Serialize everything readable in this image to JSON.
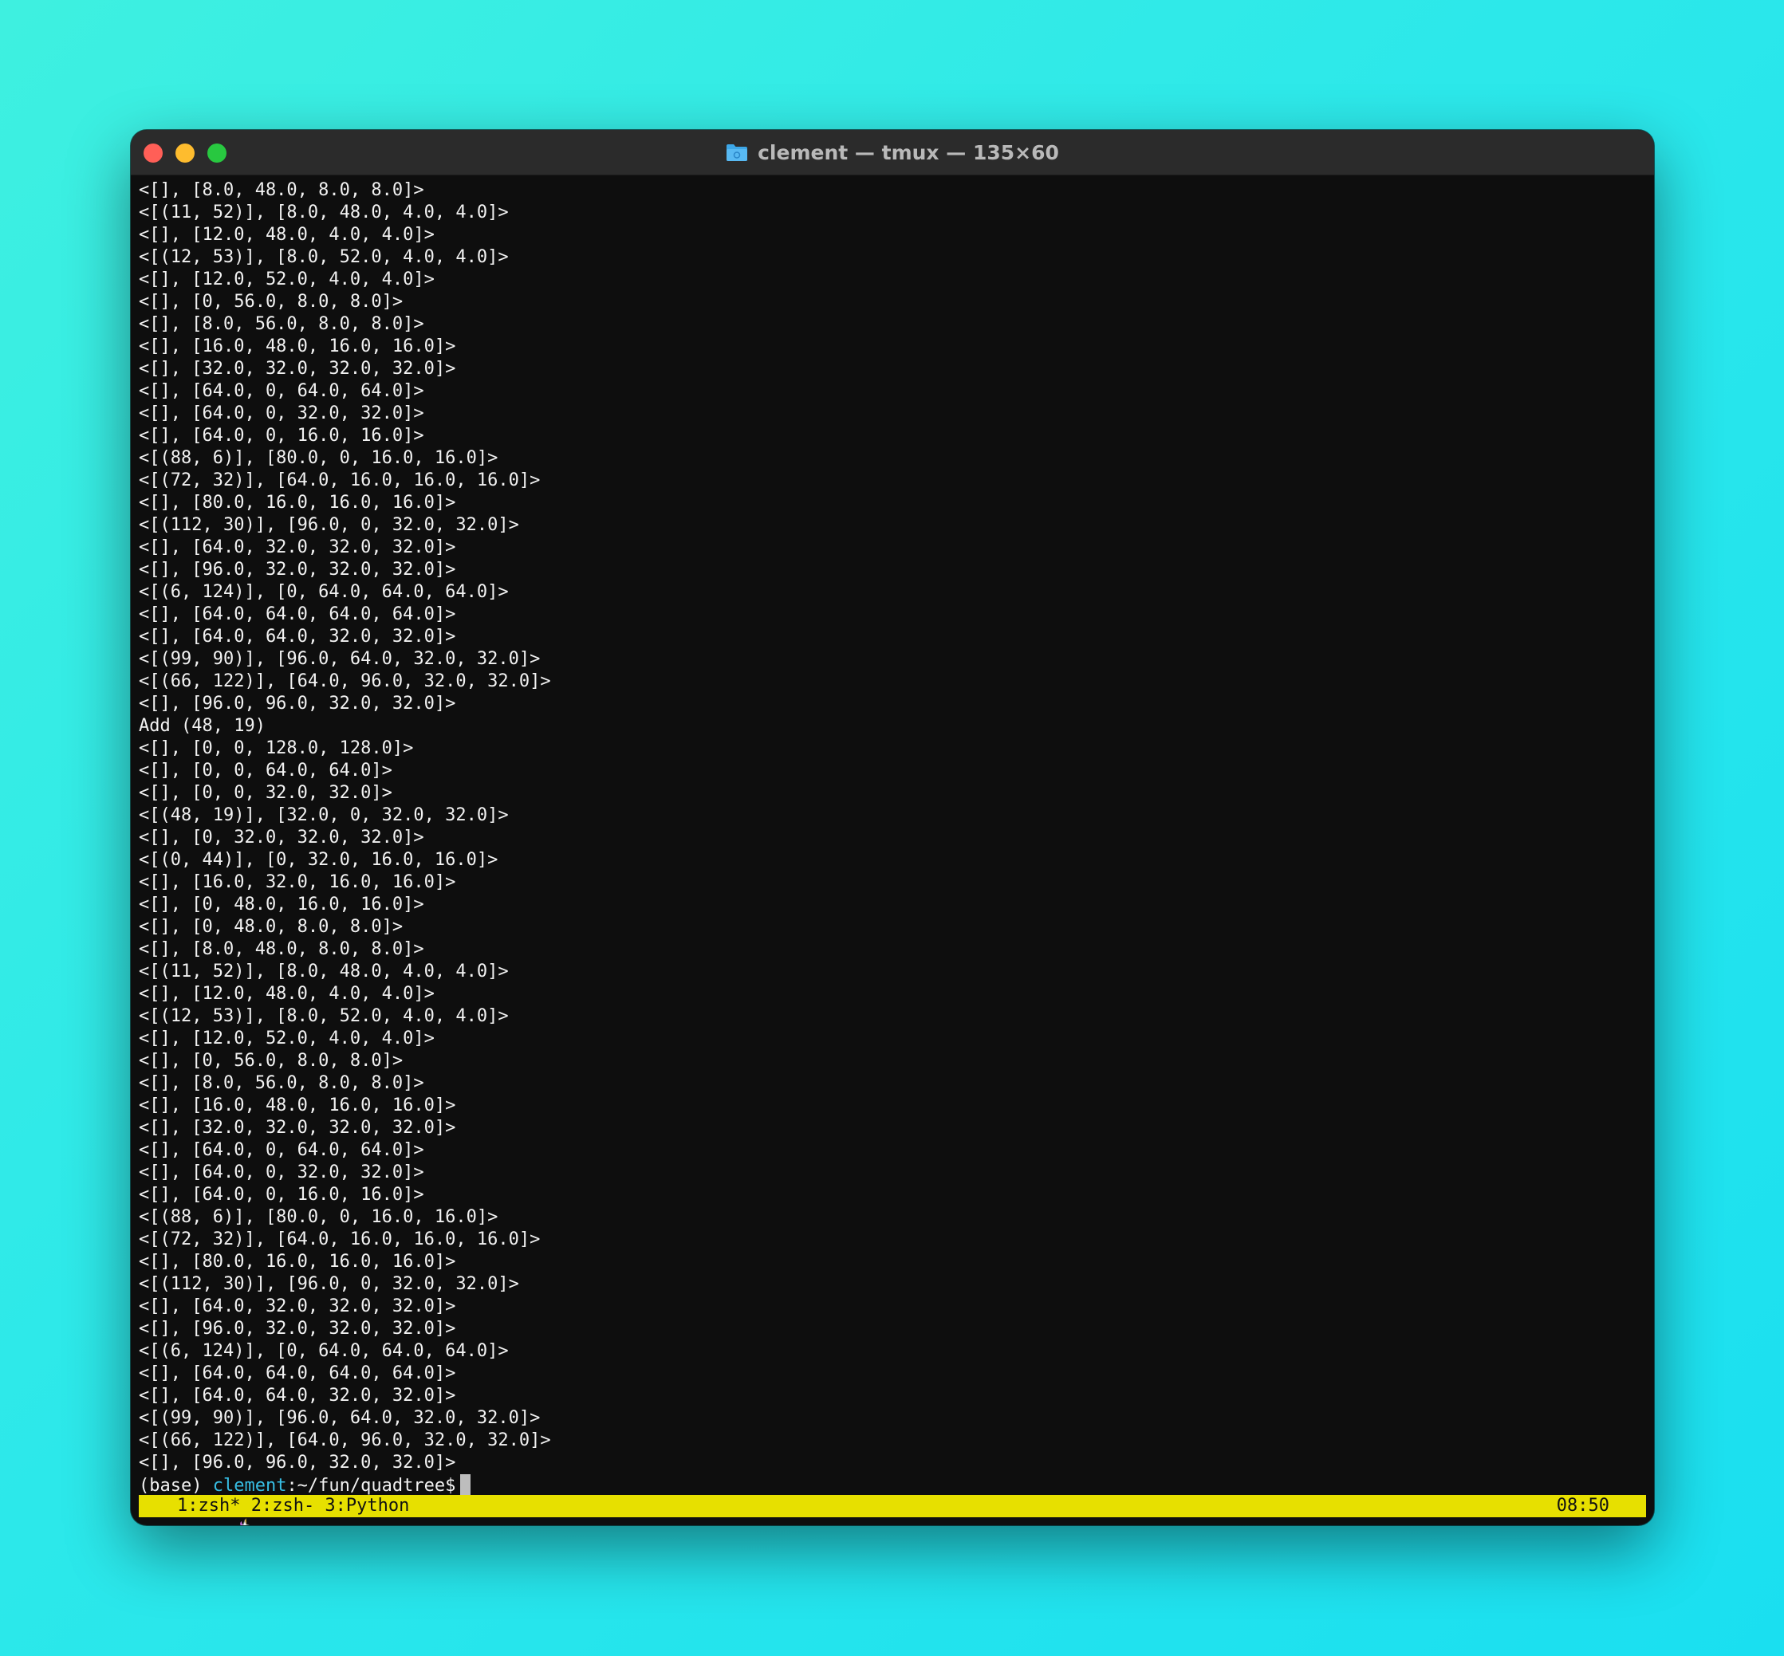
{
  "window": {
    "title": "clement — tmux — 135×60",
    "folder_icon": "folder-icon"
  },
  "terminal": {
    "lines": [
      "<[], [8.0, 48.0, 8.0, 8.0]>",
      "<[(11, 52)], [8.0, 48.0, 4.0, 4.0]>",
      "<[], [12.0, 48.0, 4.0, 4.0]>",
      "<[(12, 53)], [8.0, 52.0, 4.0, 4.0]>",
      "<[], [12.0, 52.0, 4.0, 4.0]>",
      "<[], [0, 56.0, 8.0, 8.0]>",
      "<[], [8.0, 56.0, 8.0, 8.0]>",
      "<[], [16.0, 48.0, 16.0, 16.0]>",
      "<[], [32.0, 32.0, 32.0, 32.0]>",
      "<[], [64.0, 0, 64.0, 64.0]>",
      "<[], [64.0, 0, 32.0, 32.0]>",
      "<[], [64.0, 0, 16.0, 16.0]>",
      "<[(88, 6)], [80.0, 0, 16.0, 16.0]>",
      "<[(72, 32)], [64.0, 16.0, 16.0, 16.0]>",
      "<[], [80.0, 16.0, 16.0, 16.0]>",
      "<[(112, 30)], [96.0, 0, 32.0, 32.0]>",
      "<[], [64.0, 32.0, 32.0, 32.0]>",
      "<[], [96.0, 32.0, 32.0, 32.0]>",
      "<[(6, 124)], [0, 64.0, 64.0, 64.0]>",
      "<[], [64.0, 64.0, 64.0, 64.0]>",
      "<[], [64.0, 64.0, 32.0, 32.0]>",
      "<[(99, 90)], [96.0, 64.0, 32.0, 32.0]>",
      "<[(66, 122)], [64.0, 96.0, 32.0, 32.0]>",
      "<[], [96.0, 96.0, 32.0, 32.0]>",
      "Add (48, 19)",
      "<[], [0, 0, 128.0, 128.0]>",
      "<[], [0, 0, 64.0, 64.0]>",
      "<[], [0, 0, 32.0, 32.0]>",
      "<[(48, 19)], [32.0, 0, 32.0, 32.0]>",
      "<[], [0, 32.0, 32.0, 32.0]>",
      "<[(0, 44)], [0, 32.0, 16.0, 16.0]>",
      "<[], [16.0, 32.0, 16.0, 16.0]>",
      "<[], [0, 48.0, 16.0, 16.0]>",
      "<[], [0, 48.0, 8.0, 8.0]>",
      "<[], [8.0, 48.0, 8.0, 8.0]>",
      "<[(11, 52)], [8.0, 48.0, 4.0, 4.0]>",
      "<[], [12.0, 48.0, 4.0, 4.0]>",
      "<[(12, 53)], [8.0, 52.0, 4.0, 4.0]>",
      "<[], [12.0, 52.0, 4.0, 4.0]>",
      "<[], [0, 56.0, 8.0, 8.0]>",
      "<[], [8.0, 56.0, 8.0, 8.0]>",
      "<[], [16.0, 48.0, 16.0, 16.0]>",
      "<[], [32.0, 32.0, 32.0, 32.0]>",
      "<[], [64.0, 0, 64.0, 64.0]>",
      "<[], [64.0, 0, 32.0, 32.0]>",
      "<[], [64.0, 0, 16.0, 16.0]>",
      "<[(88, 6)], [80.0, 0, 16.0, 16.0]>",
      "<[(72, 32)], [64.0, 16.0, 16.0, 16.0]>",
      "<[], [80.0, 16.0, 16.0, 16.0]>",
      "<[(112, 30)], [96.0, 0, 32.0, 32.0]>",
      "<[], [64.0, 32.0, 32.0, 32.0]>",
      "<[], [96.0, 32.0, 32.0, 32.0]>",
      "<[(6, 124)], [0, 64.0, 64.0, 64.0]>",
      "<[], [64.0, 64.0, 64.0, 64.0]>",
      "<[], [64.0, 64.0, 32.0, 32.0]>",
      "<[(99, 90)], [96.0, 64.0, 32.0, 32.0]>",
      "<[(66, 122)], [64.0, 96.0, 32.0, 32.0]>",
      "<[], [96.0, 96.0, 32.0, 32.0]>"
    ],
    "prompt": {
      "env": "(base) ",
      "user": "clement",
      "path": ":~/fun/quadtree$"
    }
  },
  "statusbar": {
    "windows": "1:zsh* 2:zsh- 3:Python",
    "time": "08:50",
    "left_icon": "unicorn-icon",
    "right_icon": "rainbow-icon",
    "background": "#e7e000"
  },
  "colors": {
    "terminal_bg": "#0e0e0e",
    "terminal_fg": "#f2f2f2",
    "prompt_user": "#37bde3",
    "close": "#ff5f57",
    "minimize": "#febc2e",
    "maximize": "#28c840"
  }
}
